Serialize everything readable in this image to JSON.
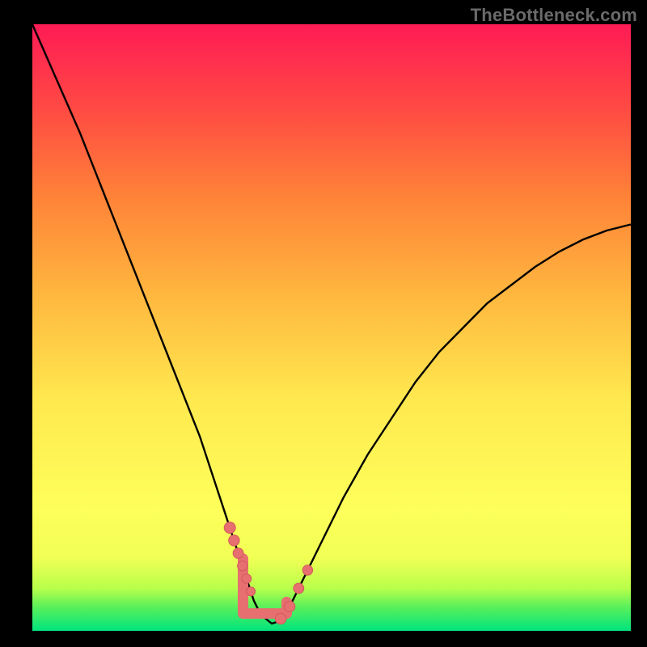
{
  "watermark": "TheBottleneck.com",
  "chart_data": {
    "type": "line",
    "title": "",
    "xlabel": "",
    "ylabel": "",
    "xlim": [
      0,
      100
    ],
    "ylim": [
      0,
      100
    ],
    "grid": false,
    "legend": false,
    "x": [
      0,
      4,
      8,
      12,
      16,
      20,
      24,
      28,
      30,
      32,
      34,
      35,
      36,
      37,
      38,
      39,
      40,
      41,
      42,
      43,
      44,
      46,
      48,
      52,
      56,
      60,
      64,
      68,
      72,
      76,
      80,
      84,
      88,
      92,
      96,
      100
    ],
    "values": [
      100,
      91,
      82,
      72,
      62,
      52,
      42,
      32,
      26,
      20,
      14,
      11,
      8,
      5,
      3,
      2,
      1.2,
      1.5,
      2.5,
      4,
      6,
      10,
      14,
      22,
      29,
      35,
      41,
      46,
      50,
      54,
      57,
      60,
      62.5,
      64.5,
      66,
      67
    ],
    "series_name": "bottleneck-curve",
    "marker_band": {
      "x_start": 33,
      "x_end": 46,
      "count_left": 6,
      "count_right": 4
    }
  },
  "bands": [
    {
      "stop": 0,
      "color": "#00e47e"
    },
    {
      "stop": 4,
      "color": "#5cf05a"
    },
    {
      "stop": 7,
      "color": "#b8ff4a"
    },
    {
      "stop": 12,
      "color": "#f1ff55"
    },
    {
      "stop": 20,
      "color": "#feff5a"
    },
    {
      "stop": 38,
      "color": "#ffe94f"
    },
    {
      "stop": 55,
      "color": "#ffb83f"
    },
    {
      "stop": 72,
      "color": "#ff8138"
    },
    {
      "stop": 86,
      "color": "#ff4a43"
    },
    {
      "stop": 100,
      "color": "#ff1b55"
    }
  ],
  "colors": {
    "curve": "#000000",
    "marker_fill": "#e76f6f",
    "marker_stroke": "#d15a5a",
    "frame": "#000000"
  }
}
